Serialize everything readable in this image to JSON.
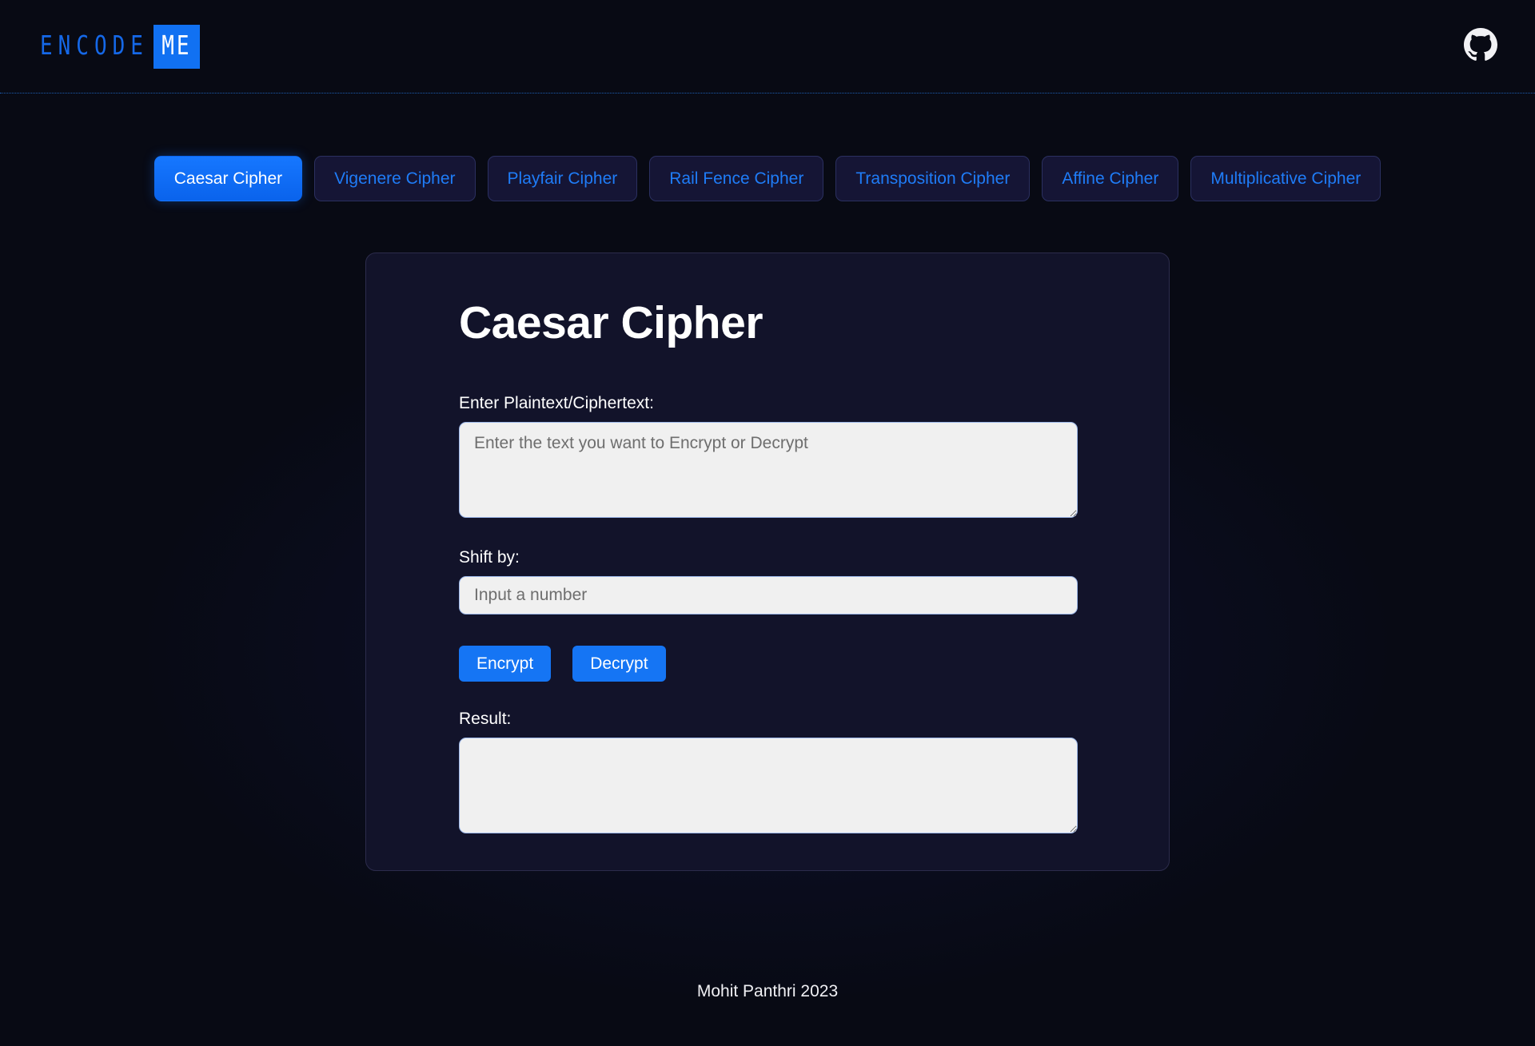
{
  "header": {
    "brand_word": "ENCODE",
    "brand_badge": "ME",
    "github_icon": "github-icon"
  },
  "tabs": [
    {
      "label": "Caesar Cipher",
      "active": true
    },
    {
      "label": "Vigenere Cipher",
      "active": false
    },
    {
      "label": "Playfair Cipher",
      "active": false
    },
    {
      "label": "Rail Fence Cipher",
      "active": false
    },
    {
      "label": "Transposition Cipher",
      "active": false
    },
    {
      "label": "Affine Cipher",
      "active": false
    },
    {
      "label": "Multiplicative Cipher",
      "active": false
    }
  ],
  "card": {
    "title": "Caesar Cipher",
    "input_label": "Enter Plaintext/Ciphertext:",
    "input_placeholder": "Enter the text you want to Encrypt or Decrypt",
    "input_value": "",
    "shift_label": "Shift by:",
    "shift_placeholder": "Input a number",
    "shift_value": "",
    "encrypt_label": "Encrypt",
    "decrypt_label": "Decrypt",
    "result_label": "Result:",
    "result_value": ""
  },
  "footer": {
    "text": "Mohit Panthri 2023"
  },
  "colors": {
    "page_background": "#080a14",
    "card_background": "#12132a",
    "card_border": "#2c2c4c",
    "accent_blue": "#1575f4",
    "tab_inactive_background": "#151535",
    "tab_inactive_text": "#1f7cf7",
    "input_background": "#f0f0f0",
    "text_primary": "#ffffff"
  }
}
